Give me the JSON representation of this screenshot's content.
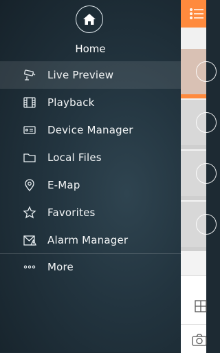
{
  "home": {
    "label": "Home",
    "icon": "home-icon"
  },
  "menu": [
    {
      "label": "Live Preview",
      "icon": "camera-icon",
      "active": true
    },
    {
      "label": "Playback",
      "icon": "film-icon"
    },
    {
      "label": "Device Manager",
      "icon": "device-icon"
    },
    {
      "label": "Local Files",
      "icon": "folder-icon"
    },
    {
      "label": "E-Map",
      "icon": "map-pin-icon"
    },
    {
      "label": "Favorites",
      "icon": "star-icon"
    },
    {
      "label": "Alarm Manager",
      "icon": "alarm-icon"
    }
  ],
  "more": {
    "label": "More",
    "icon": "more-dots-icon"
  },
  "colors": {
    "accent": "#ff8a3d",
    "drawer": "#233540"
  }
}
